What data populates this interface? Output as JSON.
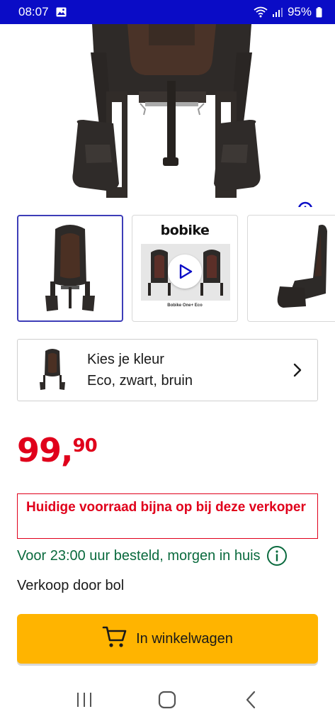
{
  "status_bar": {
    "time": "08:07",
    "battery": "95%"
  },
  "icons": {
    "gallery": "image-icon",
    "wifi": "wifi-icon",
    "signal": "signal-icon",
    "battery": "battery-icon",
    "zoom": "zoom-in-icon",
    "play": "play-icon",
    "chevron": "chevron-right-icon",
    "info": "info-icon",
    "cart": "shopping-cart-icon",
    "recent_apps": "recent-apps-icon",
    "home": "home-icon",
    "back": "back-icon"
  },
  "gallery": {
    "thumbnails": [
      {
        "type": "image",
        "selected": true
      },
      {
        "type": "video",
        "logo_text": "bobike",
        "caption": "Bobike One+ Eco"
      },
      {
        "type": "image",
        "selected": false
      }
    ]
  },
  "variant": {
    "title": "Kies je kleur",
    "value": "Eco, zwart, bruin"
  },
  "price": {
    "euros": "99,",
    "cents": "90",
    "color": "#e0001b"
  },
  "stock_warning": "Huidige voorraad bijna op bij deze verkoper",
  "delivery": "Voor 23:00 uur besteld, morgen in huis",
  "seller": "Verkoop door bol",
  "cart_button": "In winkelwagen",
  "colors": {
    "status_bar": "#0a0cc6",
    "accent_blue": "#0a0cc6",
    "cart_button": "#ffb400",
    "delivery_green": "#0a6a3e",
    "warning_red": "#e0001b"
  }
}
